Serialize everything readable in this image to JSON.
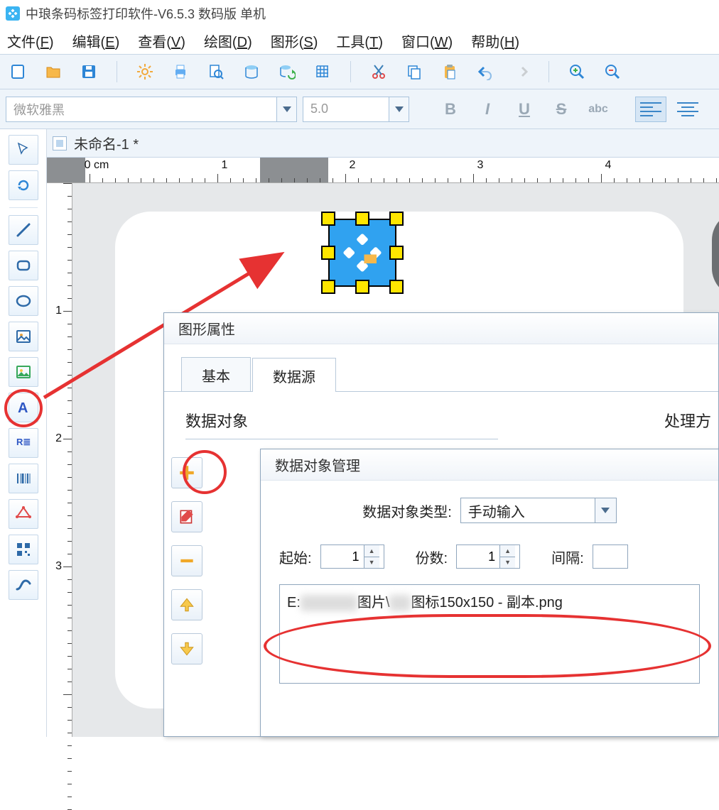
{
  "title": "中琅条码标签打印软件-V6.5.3 数码版 单机",
  "menu": {
    "file": "文件(<u>F</u>)",
    "edit": "编辑(<u>E</u>)",
    "view": "查看(<u>V</u>)",
    "draw": "绘图(<u>D</u>)",
    "shape": "图形(<u>S</u>)",
    "tool": "工具(<u>T</u>)",
    "window": "窗口(<u>W</u>)",
    "help": "帮助(<u>H</u>)"
  },
  "toolbar2": {
    "font_placeholder": "微软雅黑",
    "size_placeholder": "5.0",
    "bold": "B",
    "italic": "I",
    "underline": "U",
    "strike": "S",
    "abc": "abc"
  },
  "doc_tab": "未命名-1 *",
  "ruler": {
    "unit": "0 cm",
    "1": "1",
    "2": "2",
    "3": "3",
    "4": "4"
  },
  "vruler": {
    "1": "1",
    "2": "2",
    "3": "3"
  },
  "dlg1": {
    "title": "图形属性",
    "tab_basic": "基本",
    "tab_datasource": "数据源",
    "section_left": "数据对象",
    "section_right": "处理方"
  },
  "dlg2": {
    "title": "数据对象管理",
    "type_label": "数据对象类型:",
    "type_value": "手动输入",
    "start_label": "起始:",
    "start_value": "1",
    "copies_label": "份数:",
    "copies_value": "1",
    "gap_label": "间隔:",
    "path_prefix": "E:",
    "path_mid": "图片\\",
    "path_suffix": "图标150x150 - 副本.png"
  }
}
